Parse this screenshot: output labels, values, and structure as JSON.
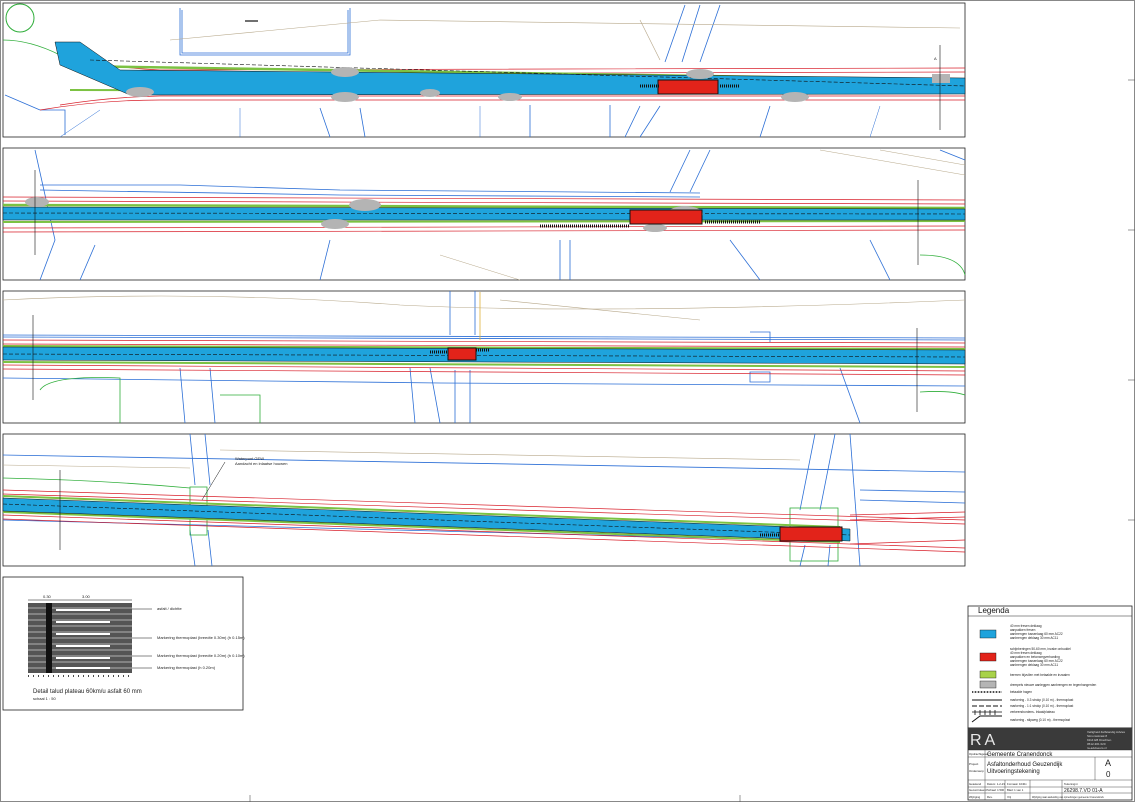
{
  "drawing": {
    "annotation": {
      "line1": "Waterpunt GEW",
      "line2": "Aandacht en inlaatse houwen"
    },
    "detail": {
      "title": "Detail talud plateau 60km/u asfalt 60 mm",
      "scale": "schaal 1 : 50",
      "dim_left": "0.30",
      "dim_top": "3.00",
      "notes": [
        "asfalt / dichtte",
        "Markering thermoplast (breedte 0.30m) (h 0.15m)",
        "Markering thermoplast (breedte 0.20m) (h 0.10m)",
        "Markering thermoplast (h 0.20m)"
      ]
    },
    "legend": {
      "title": "Legenda",
      "items": [
        {
          "swatch": "#1fa3dc",
          "lines": [
            "40 mm fresen deklaag",
            "aanpakken fresen",
            "aanbrengen tussenlaag 60 mm AC22",
            "aanbrengen deklaag 30 mm AC11"
          ]
        },
        {
          "swatch": "#e2231a",
          "lines": [
            "schijnberingen 50-60 mm, inzake onbuddel",
            "40 mm fresen deklaag",
            "aanpakken en betonwegverharding",
            "aanbrengen tussenlaag 60 mm AC22",
            "aanbrengen deklaag 30 mm AC11"
          ]
        },
        {
          "swatch": "#a8d24a",
          "lines": [
            "bermen bijvullen met betaalde en inzaaien"
          ]
        },
        {
          "swatch": "#b4b4b4",
          "lines": [
            "drempels nieuwe aanleggen aanbrengen en tegenhangerden"
          ]
        }
      ],
      "line_items": [
        "betaalde hagen",
        "markering - 0.3 strokp (0.10 m) - thermoplast",
        "markering - 1:1 strokp (0.10 m) - thermoplast",
        "verkeersbordens- Inlaat/plateau",
        "markering - stipweg (0.10 m) - thermoplast"
      ]
    },
    "titleblock": {
      "logo": "RA",
      "address": [
        "Veiligheid Zelfstandig Advies",
        "Simonsstraat 8",
        "9114 EB Drachten",
        "0512-301 020",
        "ra-adviseurs.nl"
      ],
      "client_label": "Opdrachtgever",
      "client": "Gemeente Cranendonck",
      "project_label": "Project",
      "project": "Asfaltonderhoud Geuzendijk",
      "subject_label": "Onderwerp",
      "subject": "Uitvoeringstekening",
      "format_a": "A",
      "format_num": "0",
      "row1": [
        "Getekend",
        "Datum: 1-2-23",
        "Formaat: 1040x",
        "Tekeningnr."
      ],
      "row2": [
        "Gecontroleerd",
        "Schaal: 1:500",
        "Blad: 1 van 1",
        "26298.7.VO 01-A"
      ],
      "row3": [
        "Wijziging",
        "Rev.",
        "Vrij",
        "Wijziging naar aanleiding van opmerkingen gemeente Cranendonck"
      ]
    }
  }
}
